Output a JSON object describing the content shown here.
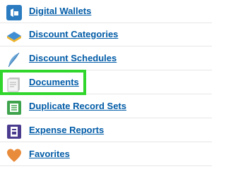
{
  "items": [
    {
      "label": "Digital Wallets",
      "icon": "wallet-icon",
      "color": "#2a7bc0"
    },
    {
      "label": "Discount Categories",
      "icon": "tag-icon",
      "color": "#3f8fd6"
    },
    {
      "label": "Discount Schedules",
      "icon": "feather-icon",
      "color": "#6aa7d9"
    },
    {
      "label": "Documents",
      "icon": "document-icon",
      "color": "#c8c8c8"
    },
    {
      "label": "Duplicate Record Sets",
      "icon": "duplicate-icon",
      "color": "#3fa34d"
    },
    {
      "label": "Expense Reports",
      "icon": "receipt-icon",
      "color": "#4b3b8f"
    },
    {
      "label": "Favorites",
      "icon": "heart-icon",
      "color": "#e88b3a"
    }
  ],
  "highlight": {
    "target": "Documents",
    "color": "#31d62c"
  }
}
